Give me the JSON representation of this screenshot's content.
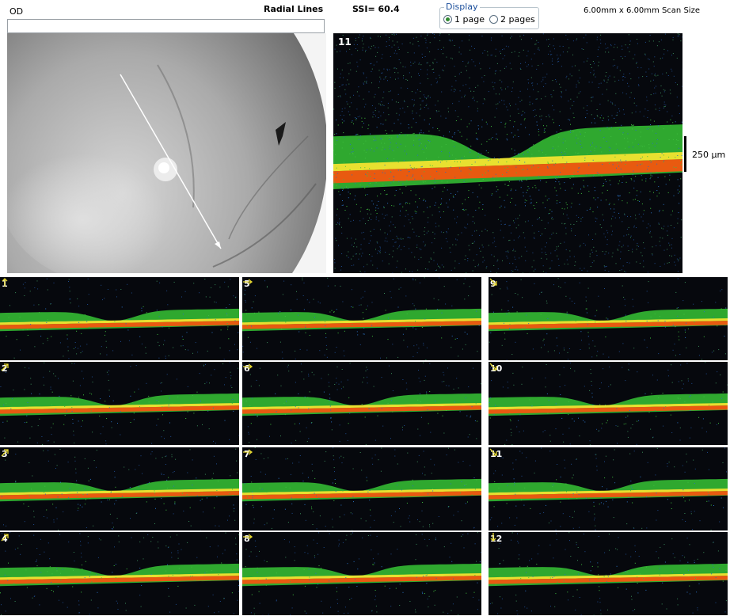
{
  "header": {
    "eye": "OD",
    "scan_pattern": "Radial Lines",
    "ssi": "SSI= 60.4",
    "scan_size": "6.00mm x 6.00mm Scan Size"
  },
  "display": {
    "legend": "Display",
    "options": [
      {
        "label": "1 page",
        "selected": true
      },
      {
        "label": "2 pages",
        "selected": false
      }
    ]
  },
  "main_scan": {
    "number": "11",
    "scale_label": "250 µm"
  },
  "thumbnails": [
    {
      "number": "1",
      "dir_icon": "arrow-up-icon"
    },
    {
      "number": "2",
      "dir_icon": "arrow-up-right-icon"
    },
    {
      "number": "3",
      "dir_icon": "arrow-up-right-icon"
    },
    {
      "number": "4",
      "dir_icon": "arrow-up-right-icon"
    },
    {
      "number": "5",
      "dir_icon": "arrow-right-icon"
    },
    {
      "number": "6",
      "dir_icon": "arrow-right-icon"
    },
    {
      "number": "7",
      "dir_icon": "arrow-right-icon"
    },
    {
      "number": "8",
      "dir_icon": "arrow-right-icon"
    },
    {
      "number": "9",
      "dir_icon": "arrow-down-right-icon"
    },
    {
      "number": "10",
      "dir_icon": "arrow-down-right-icon"
    },
    {
      "number": "11",
      "dir_icon": "arrow-down-right-icon"
    },
    {
      "number": "12",
      "dir_icon": "arrow-down-icon"
    }
  ],
  "colors": {
    "retina_layer": "#2fa82f",
    "rpe_layer": "#e85a10",
    "highlight": "#e8e030",
    "background": "#06080d",
    "arrow_icon": "#e6d830"
  }
}
